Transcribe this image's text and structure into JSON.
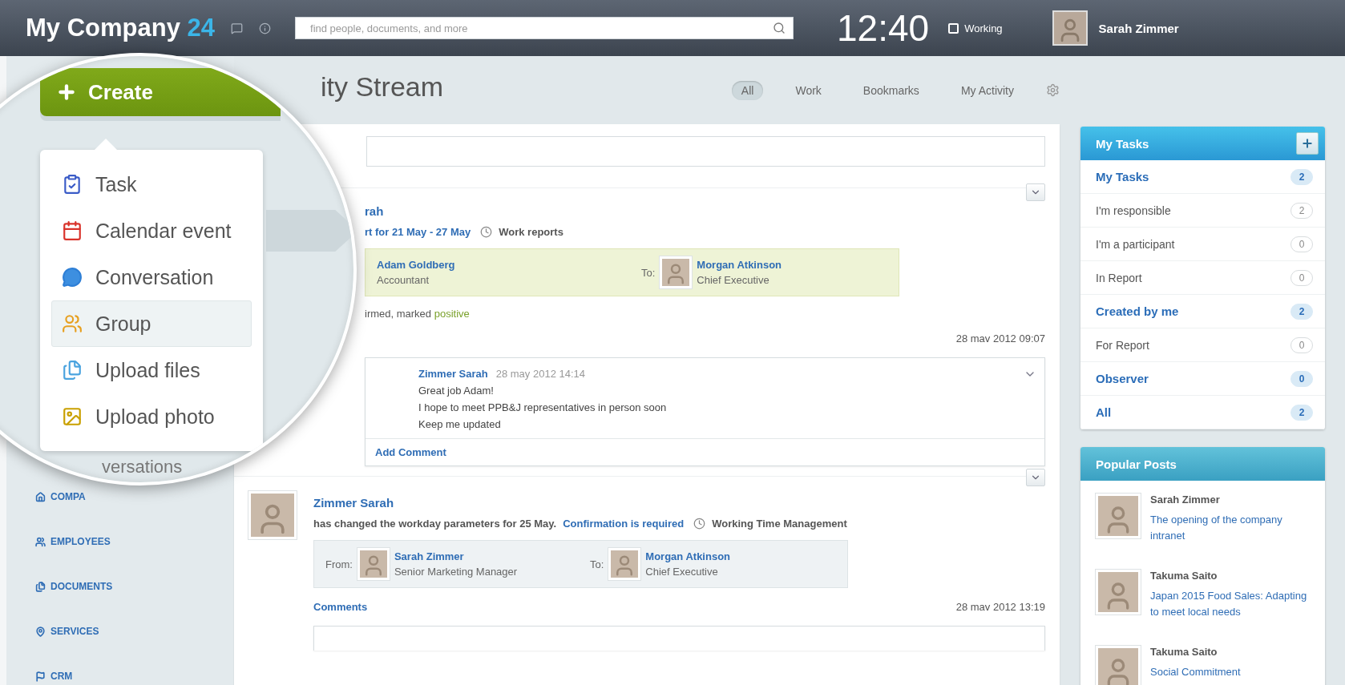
{
  "header": {
    "logo": "My Company",
    "logo_number": "24",
    "search": {
      "placeholder": "find people, documents, and more"
    },
    "clock": "12:40",
    "status": {
      "label": "Working",
      "checked": false
    },
    "user": "Sarah Zimmer"
  },
  "lens": {
    "create_button": "Create",
    "menu": [
      {
        "label": "Task",
        "selected": false
      },
      {
        "label": "Calendar event",
        "selected": false
      },
      {
        "label": "Conversation",
        "selected": false
      },
      {
        "label": "Group",
        "selected": true
      },
      {
        "label": "Upload files",
        "selected": false
      },
      {
        "label": "Upload photo",
        "selected": false
      }
    ],
    "fragment": "versations"
  },
  "sidebar": {
    "items": [
      {
        "label": "COMPA"
      },
      {
        "label": "EMPLOYEES"
      },
      {
        "label": "DOCUMENTS"
      },
      {
        "label": "SERVICES"
      },
      {
        "label": "CRM"
      }
    ]
  },
  "stream": {
    "title": "ity Stream",
    "filters": [
      {
        "label": "All",
        "selected": true
      },
      {
        "label": "Work",
        "selected": false
      },
      {
        "label": "Bookmarks",
        "selected": false
      },
      {
        "label": "My Activity",
        "selected": false
      }
    ],
    "posts": [
      {
        "author": "rah",
        "avatar": false,
        "link": "rt for 21 May - 27 May",
        "category": "Work reports",
        "report": {
          "kind": "confirmed",
          "from": {
            "name": "Adam Goldberg",
            "role": "Accountant",
            "avatar": false
          },
          "to": {
            "label": "To:",
            "name": "Morgan Atkinson",
            "role": "Chief Executive",
            "avatar": true
          }
        },
        "result": {
          "text": "irmed, marked",
          "mark": "positive"
        },
        "date": "28 mav 2012 09:07",
        "comments": [
          {
            "author": "Zimmer Sarah",
            "time": "28 may 2012 14:14",
            "lines": [
              "Great job Adam!",
              "I hope to meet PPB&J representatives in person soon",
              "Keep me updated"
            ]
          }
        ],
        "add_comment": "Add Comment"
      },
      {
        "author": "Zimmer Sarah",
        "avatar": true,
        "text": "has changed the workday parameters for 25 May.",
        "link": "Confirmation is required",
        "category": "Working Time Management",
        "report": {
          "kind": "pending",
          "from": {
            "label": "From:",
            "name": "Sarah Zimmer",
            "role": "Senior Marketing Manager",
            "avatar": true
          },
          "to": {
            "label": "To:",
            "name": "Morgan Atkinson",
            "role": "Chief Executive",
            "avatar": true
          }
        },
        "comments_link": "Comments",
        "date": "28 mav 2012 13:19"
      }
    ]
  },
  "tasks": {
    "title": "My Tasks",
    "items": [
      {
        "label": "My Tasks",
        "count": "2",
        "emphasized": true
      },
      {
        "label": "I'm responsible",
        "count": "2",
        "emphasized": false
      },
      {
        "label": "I'm a participant",
        "count": "0",
        "emphasized": false
      },
      {
        "label": "In Report",
        "count": "0",
        "emphasized": false
      },
      {
        "label": "Created by me",
        "count": "2",
        "emphasized": true
      },
      {
        "label": "For Report",
        "count": "0",
        "emphasized": false
      },
      {
        "label": "Observer",
        "count": "0",
        "emphasized": true
      },
      {
        "label": "All",
        "count": "2",
        "emphasized": true
      }
    ]
  },
  "popular": {
    "title": "Popular Posts",
    "items": [
      {
        "author": "Sarah Zimmer",
        "title": "The opening of the company intranet"
      },
      {
        "author": "Takuma Saito",
        "title": "Japan 2015 Food Sales: Adapting to meet local needs"
      },
      {
        "author": "Takuma Saito",
        "title": "Social Commitment"
      }
    ]
  }
}
